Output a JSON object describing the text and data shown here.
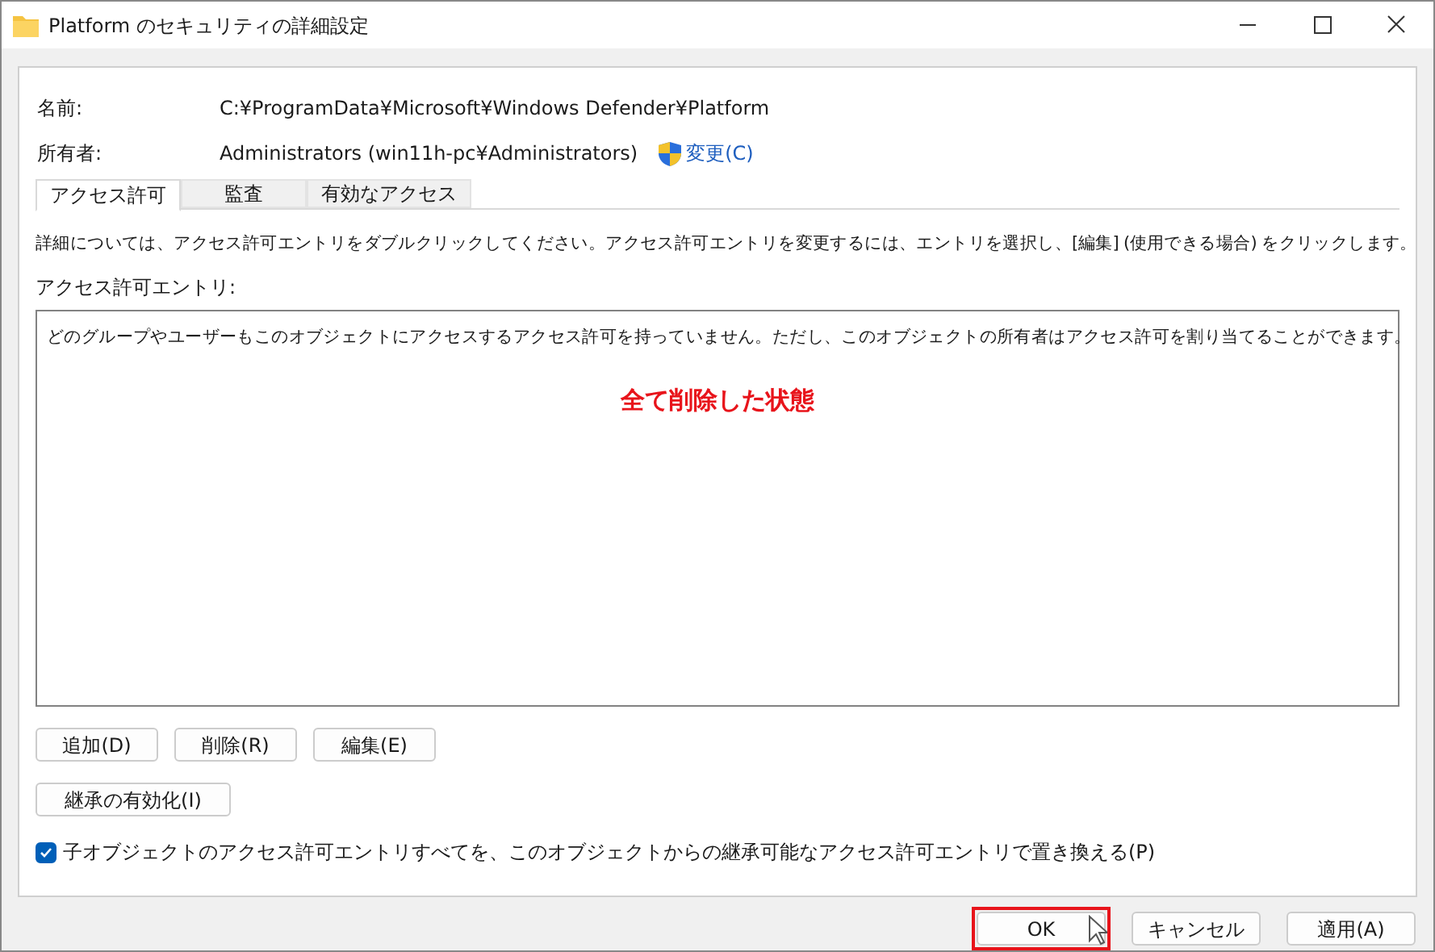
{
  "window": {
    "title": "Platform のセキュリティの詳細設定"
  },
  "fields": [
    {
      "label": "名前:",
      "value": "C:¥ProgramData¥Microsoft¥Windows Defender¥Platform"
    },
    {
      "label": "所有者:",
      "value": "Administrators (win11h-pc¥Administrators)",
      "link": "変更(C)"
    }
  ],
  "tabs": [
    {
      "label": "アクセス許可",
      "selected": true
    },
    {
      "label": "監査",
      "selected": false
    },
    {
      "label": "有効なアクセス",
      "selected": false
    }
  ],
  "description": "詳細については、アクセス許可エントリをダブルクリックしてください。アクセス許可エントリを変更するには、エントリを選択し、[編集] (使用できる場合) をクリックします。",
  "entries_label": "アクセス許可エントリ:",
  "entries_message": "どのグループやユーザーもこのオブジェクトにアクセスするアクセス許可を持っていません。ただし、このオブジェクトの所有者はアクセス許可を割り当てることができます。",
  "annotation": "全て削除した状態",
  "entry_buttons": [
    "追加(D)",
    "削除(R)",
    "編集(E)"
  ],
  "inherit_button": "継承の有効化(I)",
  "replace_checkbox": {
    "label": "子オブジェクトのアクセス許可エントリすべてを、このオブジェクトからの継承可能なアクセス許可エントリで置き換える(P)",
    "checked": true
  },
  "dialog_buttons": [
    {
      "label": "OK",
      "highlighted": true
    },
    {
      "label": "キャンセル",
      "highlighted": false
    },
    {
      "label": "適用(A)",
      "highlighted": false
    }
  ]
}
